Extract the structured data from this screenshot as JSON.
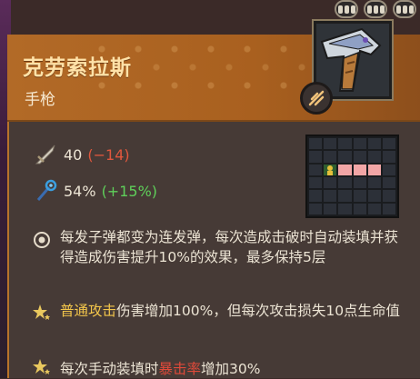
{
  "item": {
    "name": "克劳索拉斯",
    "type": "手枪"
  },
  "rank": {
    "count": 3
  },
  "stats": {
    "attack": {
      "value": "40",
      "delta": "(−14)"
    },
    "crit": {
      "value": "54%",
      "delta": "(+15%)"
    }
  },
  "range_grid": {
    "rows": 6,
    "cols": 6,
    "player_cell": [
      2,
      1
    ],
    "hit_cells": [
      [
        2,
        2
      ],
      [
        2,
        3
      ],
      [
        2,
        4
      ]
    ]
  },
  "effects": [
    {
      "icon": "target-icon",
      "text": "每发子弹都变为连发弹，每次造成击破时自动装填并获得造成伤害提升10%的效果，最多保持5层"
    },
    {
      "icon": "star-icon",
      "highlight": "普通攻击",
      "text": "伤害增加100%，但每次攻击损失10点生命值"
    },
    {
      "icon": "star-icon",
      "prefix": "每次手动装填时",
      "highlight": "暴击率",
      "suffix": "增加30%"
    }
  ],
  "colors": {
    "header": "#b26a27",
    "border": "#b8732a",
    "title": "#ffe2a8",
    "negative": "#e0573d",
    "positive": "#5fcf5a",
    "highlight_gold": "#f3c64b",
    "highlight_red": "#e04a3a",
    "grid_hit": "#f2a6a6"
  }
}
